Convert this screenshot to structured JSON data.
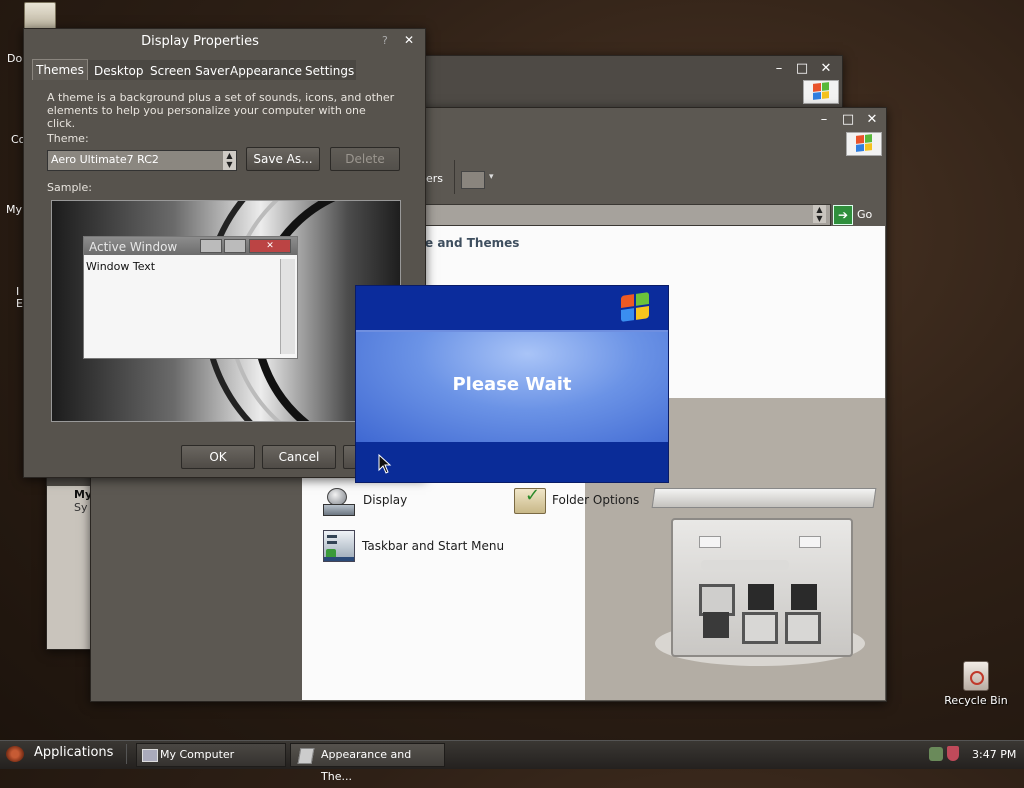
{
  "desktop": {
    "partial_labels": [
      "Do",
      "Co",
      "My",
      "I",
      "E"
    ],
    "recycle_bin_label": "Recycle Bin"
  },
  "back_window": {
    "partial_labels": [
      "My",
      "Sy"
    ]
  },
  "control_panel": {
    "toolbar_partial_text": "ers",
    "address_go_label": "Go",
    "category_heading_partial": "e and Themes",
    "items": [
      {
        "label": "Display",
        "icon": "display-icon"
      },
      {
        "label": "Folder Options",
        "icon": "folder-options-icon"
      },
      {
        "label": "Taskbar and Start Menu",
        "icon": "taskbar-start-menu-icon"
      }
    ]
  },
  "display_properties": {
    "title": "Display Properties",
    "help_glyph": "?",
    "close_glyph": "✕",
    "tabs": [
      "Themes",
      "Desktop",
      "Screen Saver",
      "Appearance",
      "Settings"
    ],
    "active_tab": "Themes",
    "description": "A theme is a background plus a set of sounds, icons, and other elements to help you personalize your computer with one click.",
    "theme_label": "Theme:",
    "theme_value": "Aero Ultimate7 RC2",
    "save_as_label": "Save As...",
    "delete_label": "Delete",
    "sample_label": "Sample:",
    "sample_window_title": "Active Window",
    "sample_window_text": "Window Text",
    "ok_label": "OK",
    "cancel_label": "Cancel"
  },
  "splash": {
    "message": "Please Wait"
  },
  "taskbar": {
    "applications_label": "Applications",
    "tasks": [
      {
        "label": "My Computer",
        "icon": "computer-icon"
      },
      {
        "label": "Appearance and The...",
        "icon": "appearance-icon"
      }
    ],
    "clock": "3:47 PM"
  },
  "colors": {
    "window_chrome": "#5a5650",
    "splash_blue": "#0a2a9a",
    "splash_mid": "#4f7be0",
    "taskbar": "#2e2b28"
  }
}
